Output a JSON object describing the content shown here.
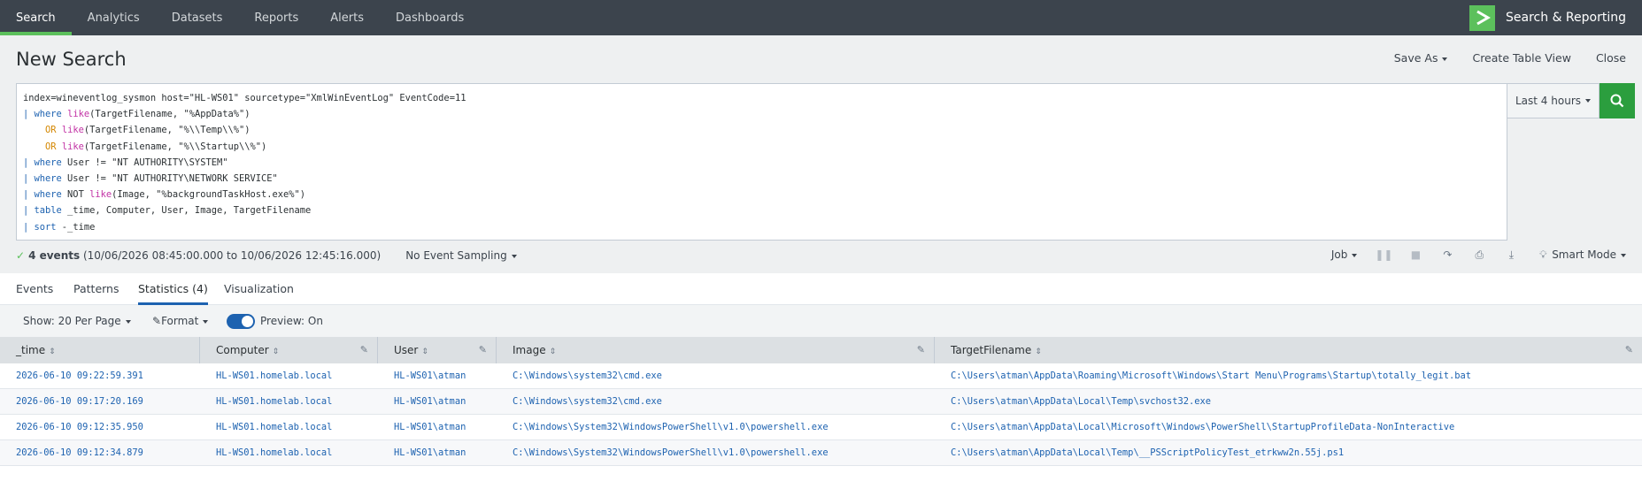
{
  "nav": {
    "tabs": [
      "Search",
      "Analytics",
      "Datasets",
      "Reports",
      "Alerts",
      "Dashboards"
    ],
    "app_name": "Search & Reporting"
  },
  "header": {
    "title": "New Search",
    "save_as": "Save As",
    "create_table_view": "Create Table View",
    "close": "Close"
  },
  "search": {
    "query_lines": [
      "index=wineventlog_sysmon host=\"HL-WS01\" sourcetype=\"XmlWinEventLog\" EventCode=11",
      "| where like(TargetFilename, \"%AppData%\")",
      "    OR like(TargetFilename, \"%\\\\Temp\\\\%\")",
      "    OR like(TargetFilename, \"%\\\\Startup\\\\%\")",
      "| where User != \"NT AUTHORITY\\SYSTEM\"",
      "| where User != \"NT AUTHORITY\\NETWORK SERVICE\"",
      "| where NOT like(Image, \"%backgroundTaskHost.exe%\")",
      "| table _time, Computer, User, Image, TargetFilename",
      "| sort -_time"
    ],
    "time_range": "Last 4 hours"
  },
  "status": {
    "events": "4 events",
    "range": "(10/06/2026 08:45:00.000 to 10/06/2026 12:45:16.000)",
    "sampling": "No Event Sampling",
    "job": "Job",
    "mode": "Smart Mode"
  },
  "result_tabs": [
    "Events",
    "Patterns",
    "Statistics (4)",
    "Visualization"
  ],
  "options": {
    "per_page": "Show: 20 Per Page",
    "format": "Format",
    "preview": "Preview: On"
  },
  "table": {
    "columns": [
      "_time",
      "Computer",
      "User",
      "Image",
      "TargetFilename"
    ],
    "rows": [
      [
        "2026-06-10 09:22:59.391",
        "HL-WS01.homelab.local",
        "HL-WS01\\atman",
        "C:\\Windows\\system32\\cmd.exe",
        "C:\\Users\\atman\\AppData\\Roaming\\Microsoft\\Windows\\Start Menu\\Programs\\Startup\\totally_legit.bat"
      ],
      [
        "2026-06-10 09:17:20.169",
        "HL-WS01.homelab.local",
        "HL-WS01\\atman",
        "C:\\Windows\\system32\\cmd.exe",
        "C:\\Users\\atman\\AppData\\Local\\Temp\\svchost32.exe"
      ],
      [
        "2026-06-10 09:12:35.950",
        "HL-WS01.homelab.local",
        "HL-WS01\\atman",
        "C:\\Windows\\System32\\WindowsPowerShell\\v1.0\\powershell.exe",
        "C:\\Users\\atman\\AppData\\Local\\Microsoft\\Windows\\PowerShell\\StartupProfileData-NonInteractive"
      ],
      [
        "2026-06-10 09:12:34.879",
        "HL-WS01.homelab.local",
        "HL-WS01\\atman",
        "C:\\Windows\\System32\\WindowsPowerShell\\v1.0\\powershell.exe",
        "C:\\Users\\atman\\AppData\\Local\\Temp\\__PSScriptPolicyTest_etrkww2n.55j.ps1"
      ]
    ]
  },
  "colors": {
    "nav_bg": "#3c444d",
    "accent_green": "#5cc05c",
    "link_blue": "#1d62b0",
    "search_green": "#2b9e3e"
  }
}
